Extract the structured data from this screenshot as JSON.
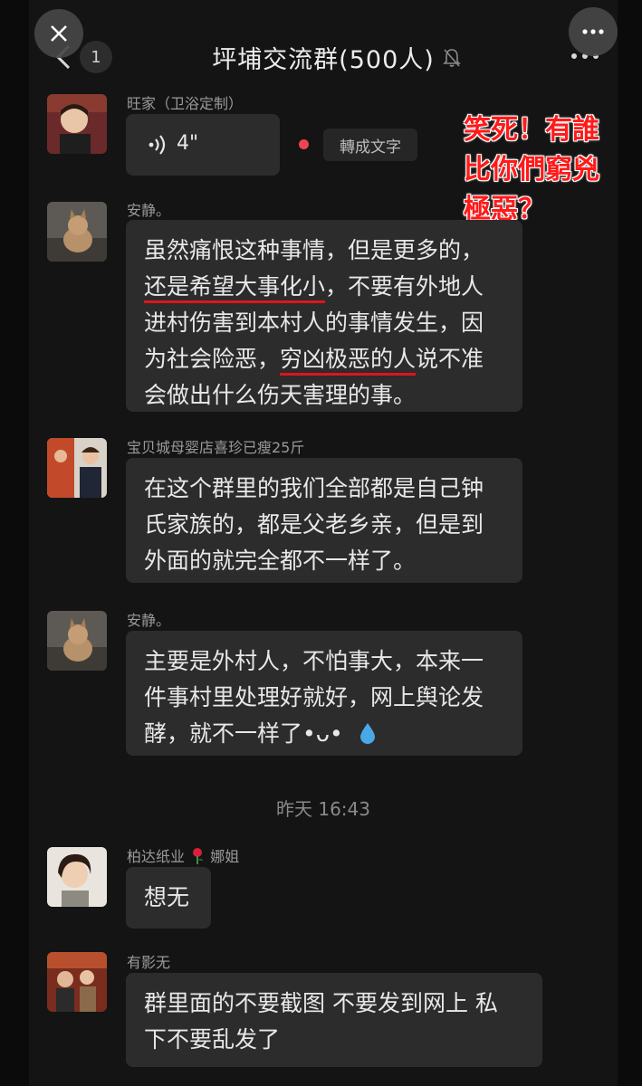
{
  "header": {
    "title": "坪埔交流群(500人)",
    "unread_count": "1"
  },
  "overlay": {
    "close_icon": "close-icon",
    "more_icon": "more-dots-icon"
  },
  "caption": {
    "lines": [
      "笑死！有誰",
      "比你們窮兇",
      "極惡？"
    ],
    "color": "#ff1a1a"
  },
  "messages": [
    {
      "sender": "旺家（卫浴定制）",
      "type": "voice",
      "duration": "4\"",
      "convert_label": "轉成文字"
    },
    {
      "sender": "安静。",
      "type": "text",
      "lines": [
        [
          "虽然痛恨这种事情，但是更多的，"
        ],
        [
          "还是希望大事化小",
          "，不要有外地人"
        ],
        [
          "进村伤害到本村人的事情发生，因"
        ],
        [
          "为社会险恶，",
          "穷凶极恶的人",
          "说不准"
        ],
        [
          "会做出什么伤天害理的事。"
        ]
      ]
    },
    {
      "sender": "宝贝城母婴店喜珍已瘦25斤",
      "type": "text",
      "lines": [
        "在这个群里的我们全部都是自己钟",
        "氏家族的，都是父老乡亲，但是到",
        "外面的就完全都不一样了。"
      ]
    },
    {
      "sender": "安静。",
      "type": "text",
      "lines": [
        "主要是外村人，不怕事大，本来一",
        "件事村里处理好就好，网上舆论发",
        "酵，就不一样了•ᴗ•"
      ]
    },
    {
      "sender_prefix": "柏达纸业",
      "sender_suffix": "娜姐",
      "type": "text",
      "lines": [
        "想无"
      ]
    },
    {
      "sender": "有影无",
      "type": "text",
      "lines": [
        "群里面的不要截图 不要发到网上  私",
        "下不要乱发了"
      ]
    }
  ],
  "timestamp": "昨天 16:43",
  "colors": {
    "background": "#141414",
    "bubble": "#2c2c2c",
    "underline": "#e0141e"
  }
}
